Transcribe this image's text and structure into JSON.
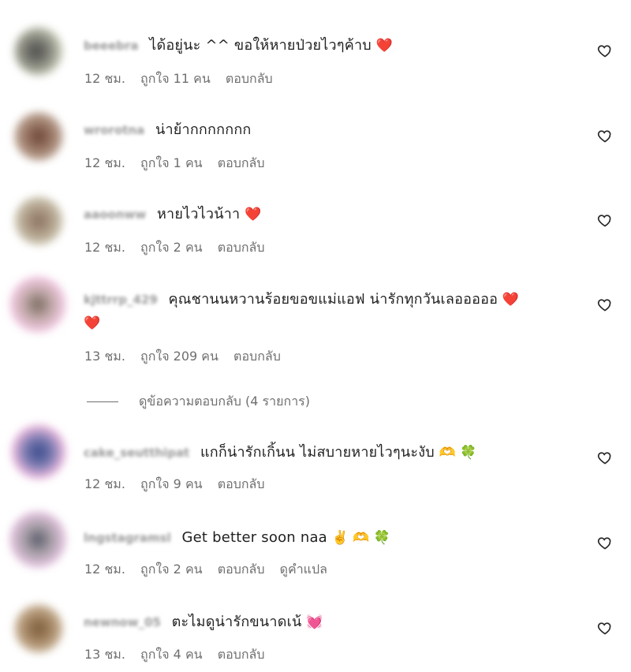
{
  "icons": {
    "heart_emoji": "❤️",
    "heart_outline": "heart-outline-icon",
    "clover": "🍀",
    "heart_hands": "🫶",
    "victory": "✌️",
    "sparkling_heart": "💓"
  },
  "colors": {
    "text": "#262626",
    "meta": "#6f6f6f",
    "username": "#9a9a9a"
  },
  "comments": [
    {
      "username": "beeebra",
      "text": "ได้อยู่นะ ^^ ขอให้หายป่วยไวๆค้าบ",
      "emoji": "❤️",
      "time": "12 ชม.",
      "likes": "ถูกใจ 11 คน",
      "reply": "ตอบกลับ"
    },
    {
      "username": "wrorotna",
      "text": "น่าย้ากกกกกกก",
      "emoji": "",
      "time": "12 ชม.",
      "likes": "ถูกใจ 1 คน",
      "reply": "ตอบกลับ"
    },
    {
      "username": "aaoonww",
      "text": "หายไวไวน้าา",
      "emoji": "❤️",
      "time": "12 ชม.",
      "likes": "ถูกใจ 2 คน",
      "reply": "ตอบกลับ"
    },
    {
      "username": "kjttrrp_429",
      "text": "คุณชานนหวานร้อยขอขแม่แอฟ น่ารักทุกวันเลอออออ",
      "emoji": "❤️",
      "emoji_line2": "❤️",
      "time": "13 ชม.",
      "likes": "ถูกใจ 209 คน",
      "reply": "ตอบกลับ"
    },
    {
      "username": "cake_seutthipat",
      "text": "แกก็น่ารักเกิ้นน ไม่สบายหายไวๆนะงับ",
      "emoji": "🫶 🍀",
      "time": "12 ชม.",
      "likes": "ถูกใจ 9 คน",
      "reply": "ตอบกลับ"
    },
    {
      "username": "lngstagramsl",
      "text": "Get better soon naa",
      "emoji": "✌️ 🫶 🍀",
      "time": "12 ชม.",
      "likes": "ถูกใจ 2 คน",
      "reply": "ตอบกลับ",
      "translate": "ดูคำแปล"
    },
    {
      "username": "newnow_05",
      "text": "ตะไมดูน่ารักขนาดเน้",
      "emoji": "💓",
      "time": "13 ชม.",
      "likes": "ถูกใจ 4 คน",
      "reply": "ตอบกลับ"
    }
  ],
  "view_replies": "ดูข้อความตอบกลับ (4 รายการ)"
}
